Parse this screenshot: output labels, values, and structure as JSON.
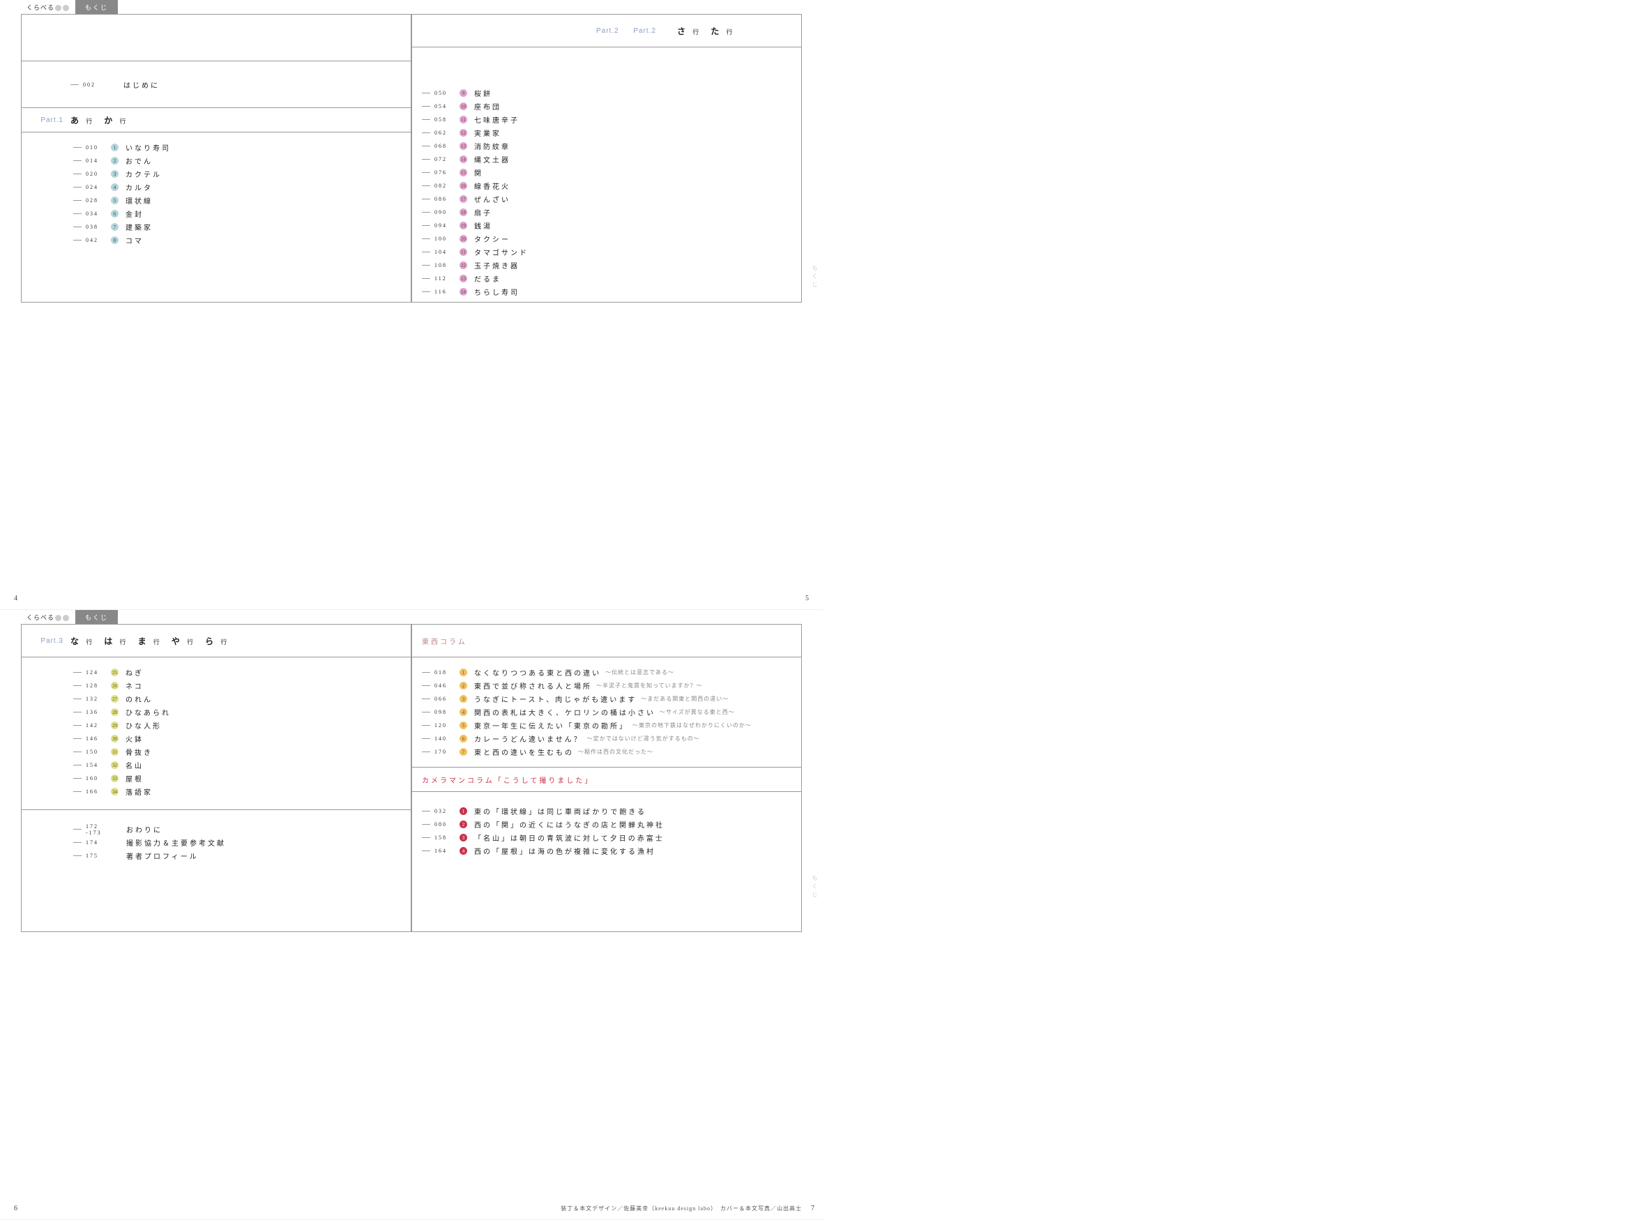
{
  "header": {
    "tag_pre": "くらべる",
    "tag_post": "",
    "mokuji": "もくじ"
  },
  "spread1": {
    "left": {
      "intro": {
        "page": "002",
        "title": "はじめに"
      },
      "part": {
        "label": "Part.1",
        "title_a": "あ",
        "title_b": "か"
      },
      "entries": [
        {
          "p": "010",
          "n": "1",
          "t": "いなり寿司"
        },
        {
          "p": "014",
          "n": "2",
          "t": "おでん"
        },
        {
          "p": "020",
          "n": "3",
          "t": "カクテル"
        },
        {
          "p": "024",
          "n": "4",
          "t": "カルタ"
        },
        {
          "p": "028",
          "n": "5",
          "t": "環状線"
        },
        {
          "p": "034",
          "n": "6",
          "t": "金封"
        },
        {
          "p": "038",
          "n": "7",
          "t": "建築家"
        },
        {
          "p": "042",
          "n": "8",
          "t": "コマ"
        }
      ],
      "pgnum": "4"
    },
    "right": {
      "part": {
        "label": "Part.2",
        "title_a": "さ",
        "title_b": "た"
      },
      "entries": [
        {
          "p": "050",
          "n": "9",
          "t": "桜餅"
        },
        {
          "p": "054",
          "n": "10",
          "t": "座布団"
        },
        {
          "p": "058",
          "n": "11",
          "t": "七味唐辛子"
        },
        {
          "p": "062",
          "n": "12",
          "t": "実業家"
        },
        {
          "p": "068",
          "n": "13",
          "t": "消防紋章"
        },
        {
          "p": "072",
          "n": "14",
          "t": "縄文土器"
        },
        {
          "p": "076",
          "n": "15",
          "t": "関"
        },
        {
          "p": "082",
          "n": "16",
          "t": "線香花火"
        },
        {
          "p": "086",
          "n": "17",
          "t": "ぜんざい"
        },
        {
          "p": "090",
          "n": "18",
          "t": "扇子"
        },
        {
          "p": "094",
          "n": "19",
          "t": "銭湯"
        },
        {
          "p": "100",
          "n": "20",
          "t": "タクシー"
        },
        {
          "p": "104",
          "n": "21",
          "t": "タマゴサンド"
        },
        {
          "p": "108",
          "n": "22",
          "t": "玉子焼き器"
        },
        {
          "p": "112",
          "n": "23",
          "t": "だるま"
        },
        {
          "p": "116",
          "n": "24",
          "t": "ちらし寿司"
        }
      ],
      "pgnum": "5",
      "side": "もくじ"
    }
  },
  "spread2": {
    "left": {
      "part": {
        "label": "Part.3",
        "title": "な は ま や ら"
      },
      "entries": [
        {
          "p": "124",
          "n": "25",
          "t": "ねぎ"
        },
        {
          "p": "128",
          "n": "26",
          "t": "ネコ"
        },
        {
          "p": "132",
          "n": "27",
          "t": "のれん"
        },
        {
          "p": "136",
          "n": "28",
          "t": "ひなあられ"
        },
        {
          "p": "142",
          "n": "29",
          "t": "ひな人形"
        },
        {
          "p": "146",
          "n": "30",
          "t": "火鉢"
        },
        {
          "p": "150",
          "n": "31",
          "t": "骨抜き"
        },
        {
          "p": "154",
          "n": "32",
          "t": "名山"
        },
        {
          "p": "160",
          "n": "33",
          "t": "屋根"
        },
        {
          "p": "166",
          "n": "34",
          "t": "落語家"
        }
      ],
      "back": [
        {
          "p": "172 -173",
          "t": "おわりに"
        },
        {
          "p": "174",
          "t": "撮影協力＆主要参考文献"
        },
        {
          "p": "175",
          "t": "著者プロフィール"
        }
      ],
      "pgnum": "6"
    },
    "right": {
      "col1": {
        "head": "東西コラム",
        "items": [
          {
            "p": "018",
            "n": "1",
            "t": "なくなりつつある東と西の違い",
            "s": "〜伝統とは意志である〜"
          },
          {
            "p": "046",
            "n": "2",
            "t": "東西で並び称される人と場所",
            "s": "〜半泥子と鬼貫を知っていますか？〜"
          },
          {
            "p": "066",
            "n": "3",
            "t": "うなぎにトースト、肉じゃがも違います",
            "s": "〜まだある関東と関西の違い〜"
          },
          {
            "p": "098",
            "n": "4",
            "t": "関西の表札は大きく、ケロリンの桶は小さい",
            "s": "〜サイズが異なる東と西〜"
          },
          {
            "p": "120",
            "n": "5",
            "t": "東京一年生に伝えたい「東京の勘所」",
            "s": "〜東京の地下鉄はなぜわかりにくいのか〜"
          },
          {
            "p": "140",
            "n": "6",
            "t": "カレーうどん違いません？",
            "s": "〜定かではないけど違う気がするもの〜"
          },
          {
            "p": "170",
            "n": "7",
            "t": "東と西の違いを生むもの",
            "s": "〜稲作は西の文化だった〜"
          }
        ]
      },
      "col2": {
        "head": "カメラマンコラム「こうして撮りました」",
        "items": [
          {
            "p": "032",
            "n": "1",
            "t": "東の「環状線」は同じ車両ばかりで飽きる"
          },
          {
            "p": "080",
            "n": "2",
            "t": "西の「関」の近くにはうなぎの店と関蝉丸神社"
          },
          {
            "p": "158",
            "n": "3",
            "t": "「名山」は朝日の青筑波に対して夕日の赤富士"
          },
          {
            "p": "164",
            "n": "4",
            "t": "西の「屋根」は海の色が複雑に変化する漁村"
          }
        ]
      },
      "pgnum": "7",
      "side": "もくじ",
      "credits": "装丁＆本文デザイン／佐藤美幸（keekuu design labo）　カバー＆本文写真／山出高士"
    }
  }
}
